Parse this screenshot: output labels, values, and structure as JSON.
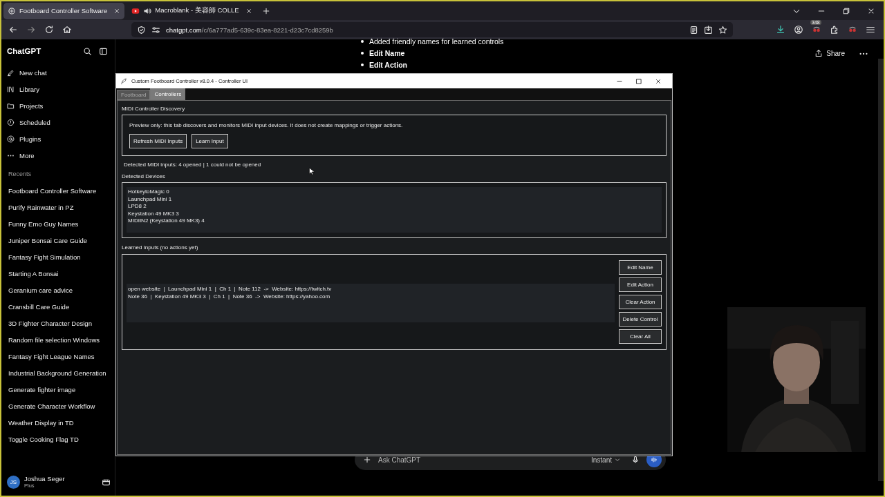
{
  "browser": {
    "tabs": [
      {
        "title": "Footboard Controller Software",
        "kind": "chat",
        "selected": true
      },
      {
        "title": "Macroblank - 美容師 COLLE",
        "kind": "video",
        "selected": false
      }
    ],
    "url_host": "chatgpt.com",
    "url_path": "/c/6a777ad5-639c-83ea-8221-d23c7cd8259b",
    "extension_badge": "348"
  },
  "sidebar": {
    "brand": "ChatGPT",
    "nav": [
      {
        "label": "New chat"
      },
      {
        "label": "Library"
      },
      {
        "label": "Projects"
      },
      {
        "label": "Scheduled"
      },
      {
        "label": "Plugins"
      },
      {
        "label": "More"
      }
    ],
    "recents_heading": "Recents",
    "recents": [
      "Footboard Controller Software",
      "Purify Rainwater in PZ",
      "Funny Emo Guy Names",
      "Juniper Bonsai Care Guide",
      "Fantasy Fight Simulation",
      "Starting A Bonsai",
      "Geranium care advice",
      "Cransbill Care Guide",
      "3D Fighter Character Design",
      "Random file selection Windows",
      "Fantasy Fight League Names",
      "Industrial Background Generation",
      "Generate fighter image",
      "Generate Character Workflow",
      "Weather Display in TD",
      "Toggle Cooking Flag TD"
    ],
    "user": {
      "initials": "JS",
      "name": "Joshua Seger",
      "plan": "Plus"
    }
  },
  "chat": {
    "bullets": [
      "Added friendly names for learned controls",
      "Edit Name",
      "Edit Action"
    ],
    "share": "Share"
  },
  "app_window": {
    "title": "Custom Footboard Controller v8.0.4 - Controller UI",
    "tabs": [
      {
        "label": "Footboard",
        "selected": false
      },
      {
        "label": "Controllers",
        "selected": true
      }
    ],
    "section_title": "MIDI Controller Discovery",
    "info_text": "Preview only: this tab discovers and monitors MIDI input devices. It does not create mappings or trigger actions.",
    "buttons": [
      "Refresh MIDI Inputs",
      "Learn Input"
    ],
    "status": "Detected MIDI inputs: 4 opened | 1 could not be opened",
    "devices_label": "Detected Devices",
    "devices": [
      "HotkeytoMagic 0",
      "Launchpad Mini 1",
      "LPD8 2",
      "Keystation 49 MK3 3",
      "MIDIIN2 (Keystation 49 MK3) 4"
    ],
    "learned_label": "Learned Inputs (no actions yet)",
    "learned": [
      "open website  |  Launchpad Mini 1  |  Ch 1  |  Note 112  ->  Website: https://twitch.tv",
      "Note 36  |  Keystation 49 MK3 3  |  Ch 1  |  Note 36  ->  Website: https://yahoo.com"
    ],
    "side_buttons": [
      "Edit Name",
      "Edit Action",
      "Clear Action",
      "Delete Control",
      "Clear All"
    ]
  },
  "composer": {
    "placeholder": "Ask ChatGPT",
    "mode": "Instant"
  }
}
